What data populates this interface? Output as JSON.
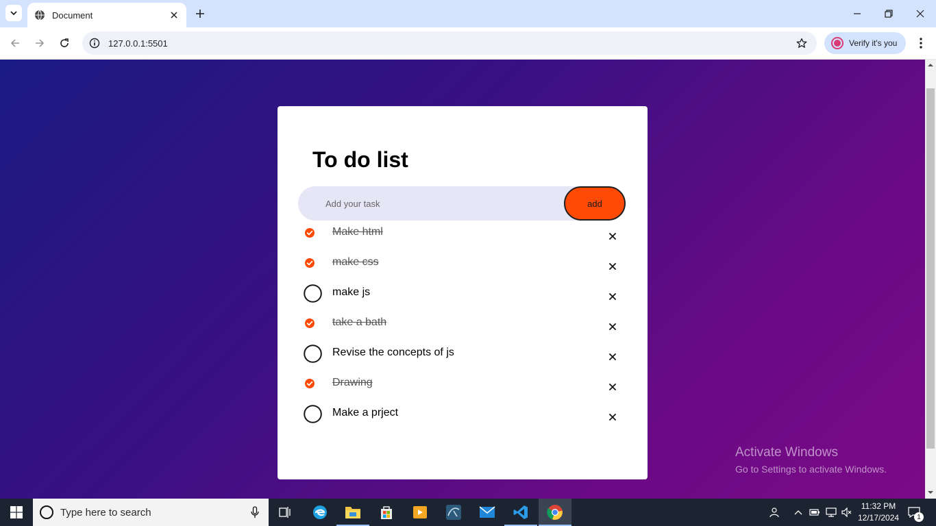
{
  "browser": {
    "tab_title": "Document",
    "url": "127.0.0.1:5501",
    "verify_label": "Verify it's you",
    "icons": {
      "tab_search": "chevron-down-icon",
      "favicon": "globe-icon",
      "tab_close": "close-icon",
      "new_tab": "plus-icon",
      "back": "arrow-left-icon",
      "forward": "arrow-right-icon",
      "reload": "reload-icon",
      "site_info": "info-icon",
      "bookmark": "star-icon",
      "menu": "kebab-icon",
      "minimize": "minimize-icon",
      "restore": "restore-icon",
      "close": "close-icon"
    }
  },
  "app": {
    "title": "To do list",
    "input_placeholder": "Add your task",
    "add_label": "add",
    "colors": {
      "accent": "#ff4a05",
      "card": "#ffffff",
      "input_bg": "#e6e6f7",
      "bg_start": "#1a1a82",
      "bg_end": "#7b0a86"
    },
    "tasks": [
      {
        "text": "Make html",
        "done": true
      },
      {
        "text": "make css",
        "done": true
      },
      {
        "text": "make js",
        "done": false
      },
      {
        "text": "take a bath",
        "done": true
      },
      {
        "text": "Revise the concepts of js",
        "done": false
      },
      {
        "text": "Drawing",
        "done": true
      },
      {
        "text": "Make a prject",
        "done": false
      }
    ]
  },
  "watermark": {
    "title": "Activate Windows",
    "subtitle": "Go to Settings to activate Windows."
  },
  "taskbar": {
    "search_placeholder": "Type here to search",
    "apps": [
      "task-view",
      "edge",
      "file-explorer",
      "microsoft-store",
      "media-player",
      "mysql-workbench",
      "mail",
      "vs-code",
      "chrome"
    ],
    "time": "11:32 PM",
    "date": "12/17/2024",
    "notification_count": "1"
  }
}
